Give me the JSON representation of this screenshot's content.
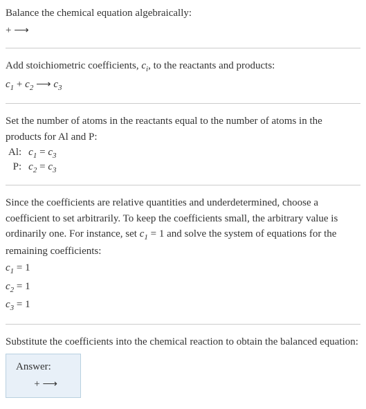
{
  "section1": {
    "title": "Balance the chemical equation algebraically:",
    "equation": " +  ⟶ "
  },
  "section2": {
    "title_part1": "Add stoichiometric coefficients, ",
    "title_ci": "c",
    "title_ci_sub": "i",
    "title_part2": ", to the reactants and products:",
    "eq_c1": "c",
    "eq_c1_sub": "1",
    "eq_plus": "  + ",
    "eq_c2": "c",
    "eq_c2_sub": "2",
    "eq_arrow": "   ⟶  ",
    "eq_c3": "c",
    "eq_c3_sub": "3"
  },
  "section3": {
    "title": "Set the number of atoms in the reactants equal to the number of atoms in the products for Al and P:",
    "row1_label": "Al:",
    "row1_c1": "c",
    "row1_c1_sub": "1",
    "row1_eq": " = ",
    "row1_c3": "c",
    "row1_c3_sub": "3",
    "row2_label": "P:",
    "row2_c2": "c",
    "row2_c2_sub": "2",
    "row2_eq": " = ",
    "row2_c3": "c",
    "row2_c3_sub": "3"
  },
  "section4": {
    "title_part1": "Since the coefficients are relative quantities and underdetermined, choose a coefficient to set arbitrarily. To keep the coefficients small, the arbitrary value is ordinarily one. For instance, set ",
    "title_c1": "c",
    "title_c1_sub": "1",
    "title_part2": " = 1 and solve the system of equations for the remaining coefficients:",
    "eq1_c": "c",
    "eq1_sub": "1",
    "eq1_rest": " = 1",
    "eq2_c": "c",
    "eq2_sub": "2",
    "eq2_rest": " = 1",
    "eq3_c": "c",
    "eq3_sub": "3",
    "eq3_rest": " = 1"
  },
  "section5": {
    "title": "Substitute the coefficients into the chemical reaction to obtain the balanced equation:",
    "answer_label": "Answer:",
    "answer_eq": " +  ⟶ "
  }
}
